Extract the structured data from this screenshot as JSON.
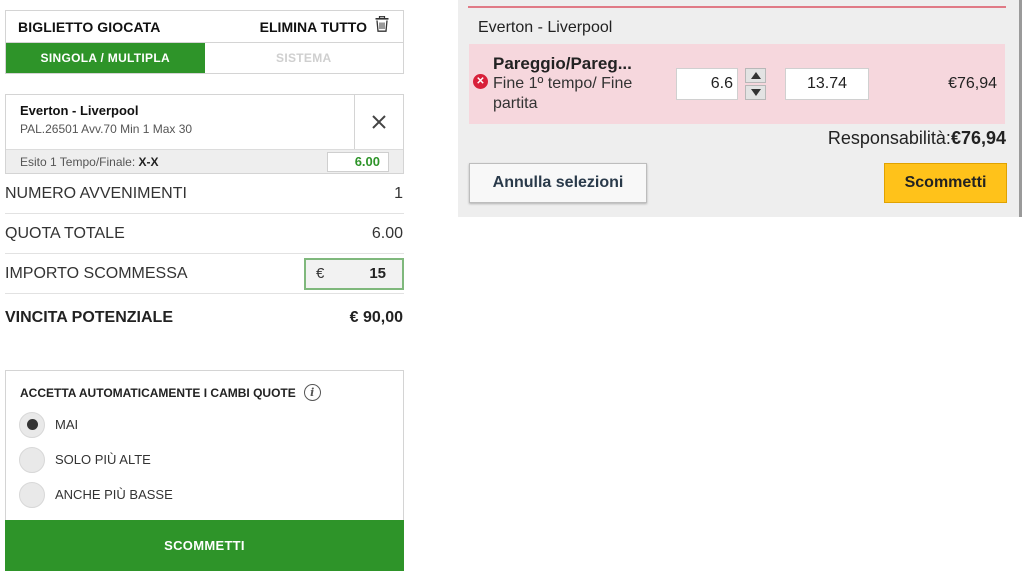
{
  "slip": {
    "title": "BIGLIETTO GIOCATA",
    "delete_all": "ELIMINA TUTTO",
    "tabs": [
      {
        "label": "SINGOLA / MULTIPLA",
        "active": true
      },
      {
        "label": "SISTEMA",
        "active": false
      }
    ],
    "event": {
      "name": "Everton - Liverpool",
      "details": "PAL.26501 Avv.70 Min 1 Max 30",
      "market_label": "Esito 1 Tempo/Finale: ",
      "market_value": "X-X",
      "odds": "6.00"
    },
    "summary": {
      "events_label": "NUMERO AVVENIMENTI",
      "events_value": "1",
      "total_odds_label": "QUOTA TOTALE",
      "total_odds_value": "6.00",
      "stake_label": "IMPORTO SCOMMESSA",
      "stake_currency": "€",
      "stake_value": "15",
      "win_label": "VINCITA POTENZIALE",
      "win_value": "€ 90,00"
    },
    "auto_accept": {
      "title": "ACCETTA AUTOMATICAMENTE I CAMBI QUOTE",
      "info_glyph": "i",
      "options": [
        {
          "label": "MAI",
          "selected": true
        },
        {
          "label": "SOLO PIÙ ALTE",
          "selected": false
        },
        {
          "label": "ANCHE PIÙ BASSE",
          "selected": false
        }
      ]
    },
    "bet_button": "SCOMMETTI"
  },
  "exchange": {
    "event": "Everton - Liverpool",
    "selection_title": "Pareggio/Pareg...",
    "selection_sub": "Fine 1º tempo/ Fine partita",
    "odds": "6.6",
    "stake": "13.74",
    "liability": "€76,94",
    "responsibility_label": "Responsabilità:",
    "responsibility_value": "€76,94",
    "cancel_button": "Annulla selezioni",
    "bet_button": "Scommetti",
    "remove_glyph": "✕",
    "colors": {
      "row_bg": "#f6d7dd",
      "bet_btn": "#ffc21a",
      "remove": "#d8203a"
    }
  },
  "icons": [
    "trash-icon",
    "close-icon",
    "info-icon",
    "remove-circle-icon",
    "spin-up-icon",
    "spin-down-icon"
  ],
  "colors": {
    "brand_green": "#2e9429"
  }
}
